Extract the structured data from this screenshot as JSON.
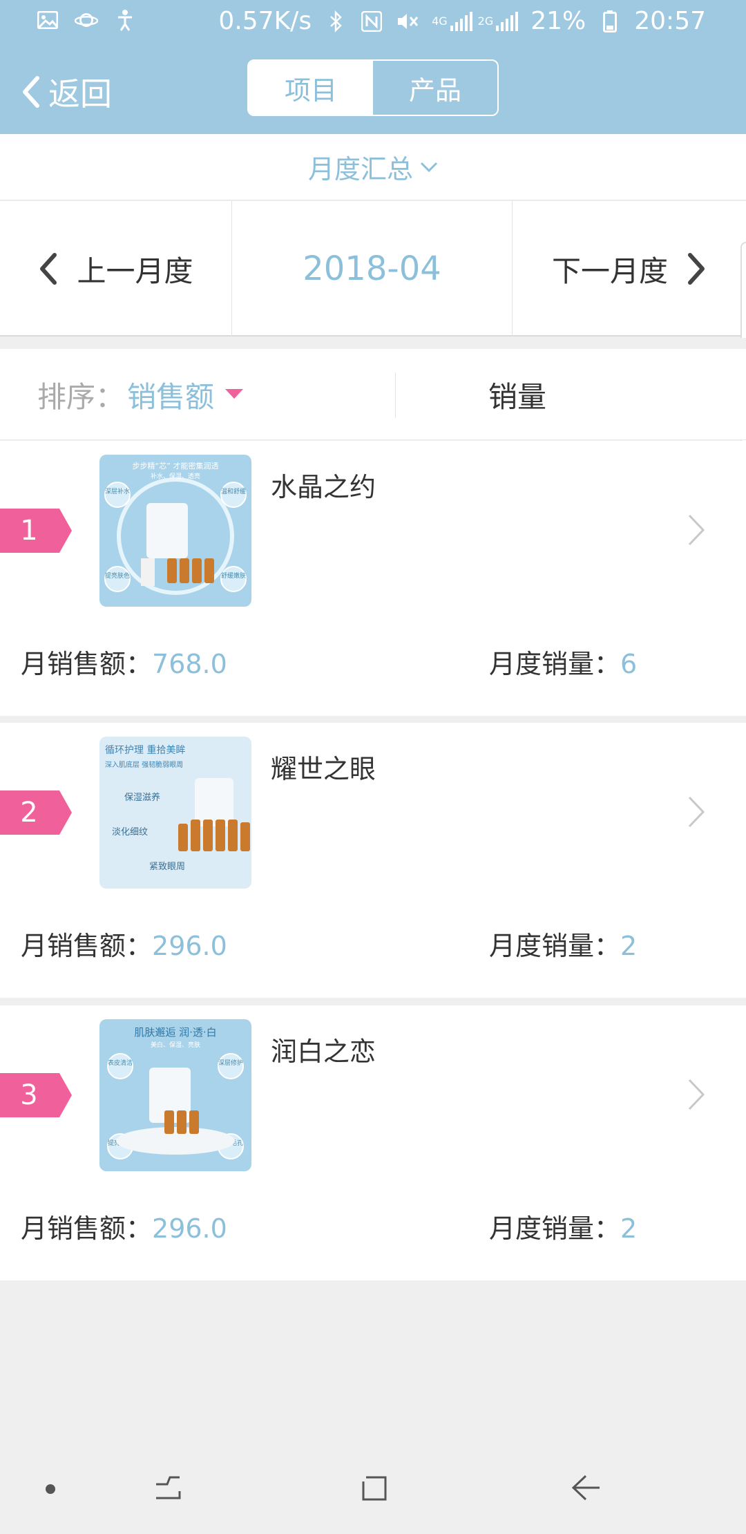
{
  "status_bar": {
    "speed": "0.57K/s",
    "net_4g": "4G",
    "net_2g": "2G",
    "battery": "21%",
    "time": "20:57",
    "icons": [
      "image-icon",
      "planet-icon",
      "accessibility-icon",
      "bluetooth-icon",
      "nfc-icon",
      "mute-icon",
      "signal-icon",
      "battery-icon"
    ]
  },
  "header": {
    "back_label": "返回",
    "tabs": [
      {
        "label": "项目",
        "active": true
      },
      {
        "label": "产品",
        "active": false
      }
    ],
    "accent_color": "#9fc9e0"
  },
  "summary": {
    "label": "月度汇总"
  },
  "month_nav": {
    "prev_label": "上一月度",
    "current": "2018-04",
    "next_label": "下一月度"
  },
  "sort_bar": {
    "label": "排序：",
    "selected": "销售额",
    "alt": "销量"
  },
  "items": [
    {
      "rank": "1",
      "name": "水晶之约",
      "sales_label": "月销售额：",
      "sales": "768.0",
      "qty_label": "月度销量：",
      "qty": "6",
      "thumb": {
        "headline": "步步精“芯” 才能密集润透",
        "sub": "补水、保湿、透亮",
        "tags": [
          "深层补水",
          "温和舒缓",
          "提亮肤色",
          "舒缓嫩肤"
        ]
      }
    },
    {
      "rank": "2",
      "name": "耀世之眼",
      "sales_label": "月销售额：",
      "sales": "296.0",
      "qty_label": "月度销量：",
      "qty": "2",
      "thumb": {
        "headline": "循环护理 重拾美眸",
        "sub": "深入肌底层 强韧脆弱眼周",
        "tags": [
          "保湿滋养",
          "淡化细纹",
          "紧致眼周"
        ]
      }
    },
    {
      "rank": "3",
      "name": "润白之恋",
      "sales_label": "月销售额：",
      "sales": "296.0",
      "qty_label": "月度销量：",
      "qty": "2",
      "thumb": {
        "headline": "肌肤邂逅 润·透·白",
        "sub": "美白、保湿、亮肤",
        "tags": [
          "表皮清洁",
          "深层修护",
          "提亮肤色",
          "细致毛孔"
        ]
      }
    }
  ],
  "rank_color": "#f0609a",
  "value_color": "#8cbfda"
}
